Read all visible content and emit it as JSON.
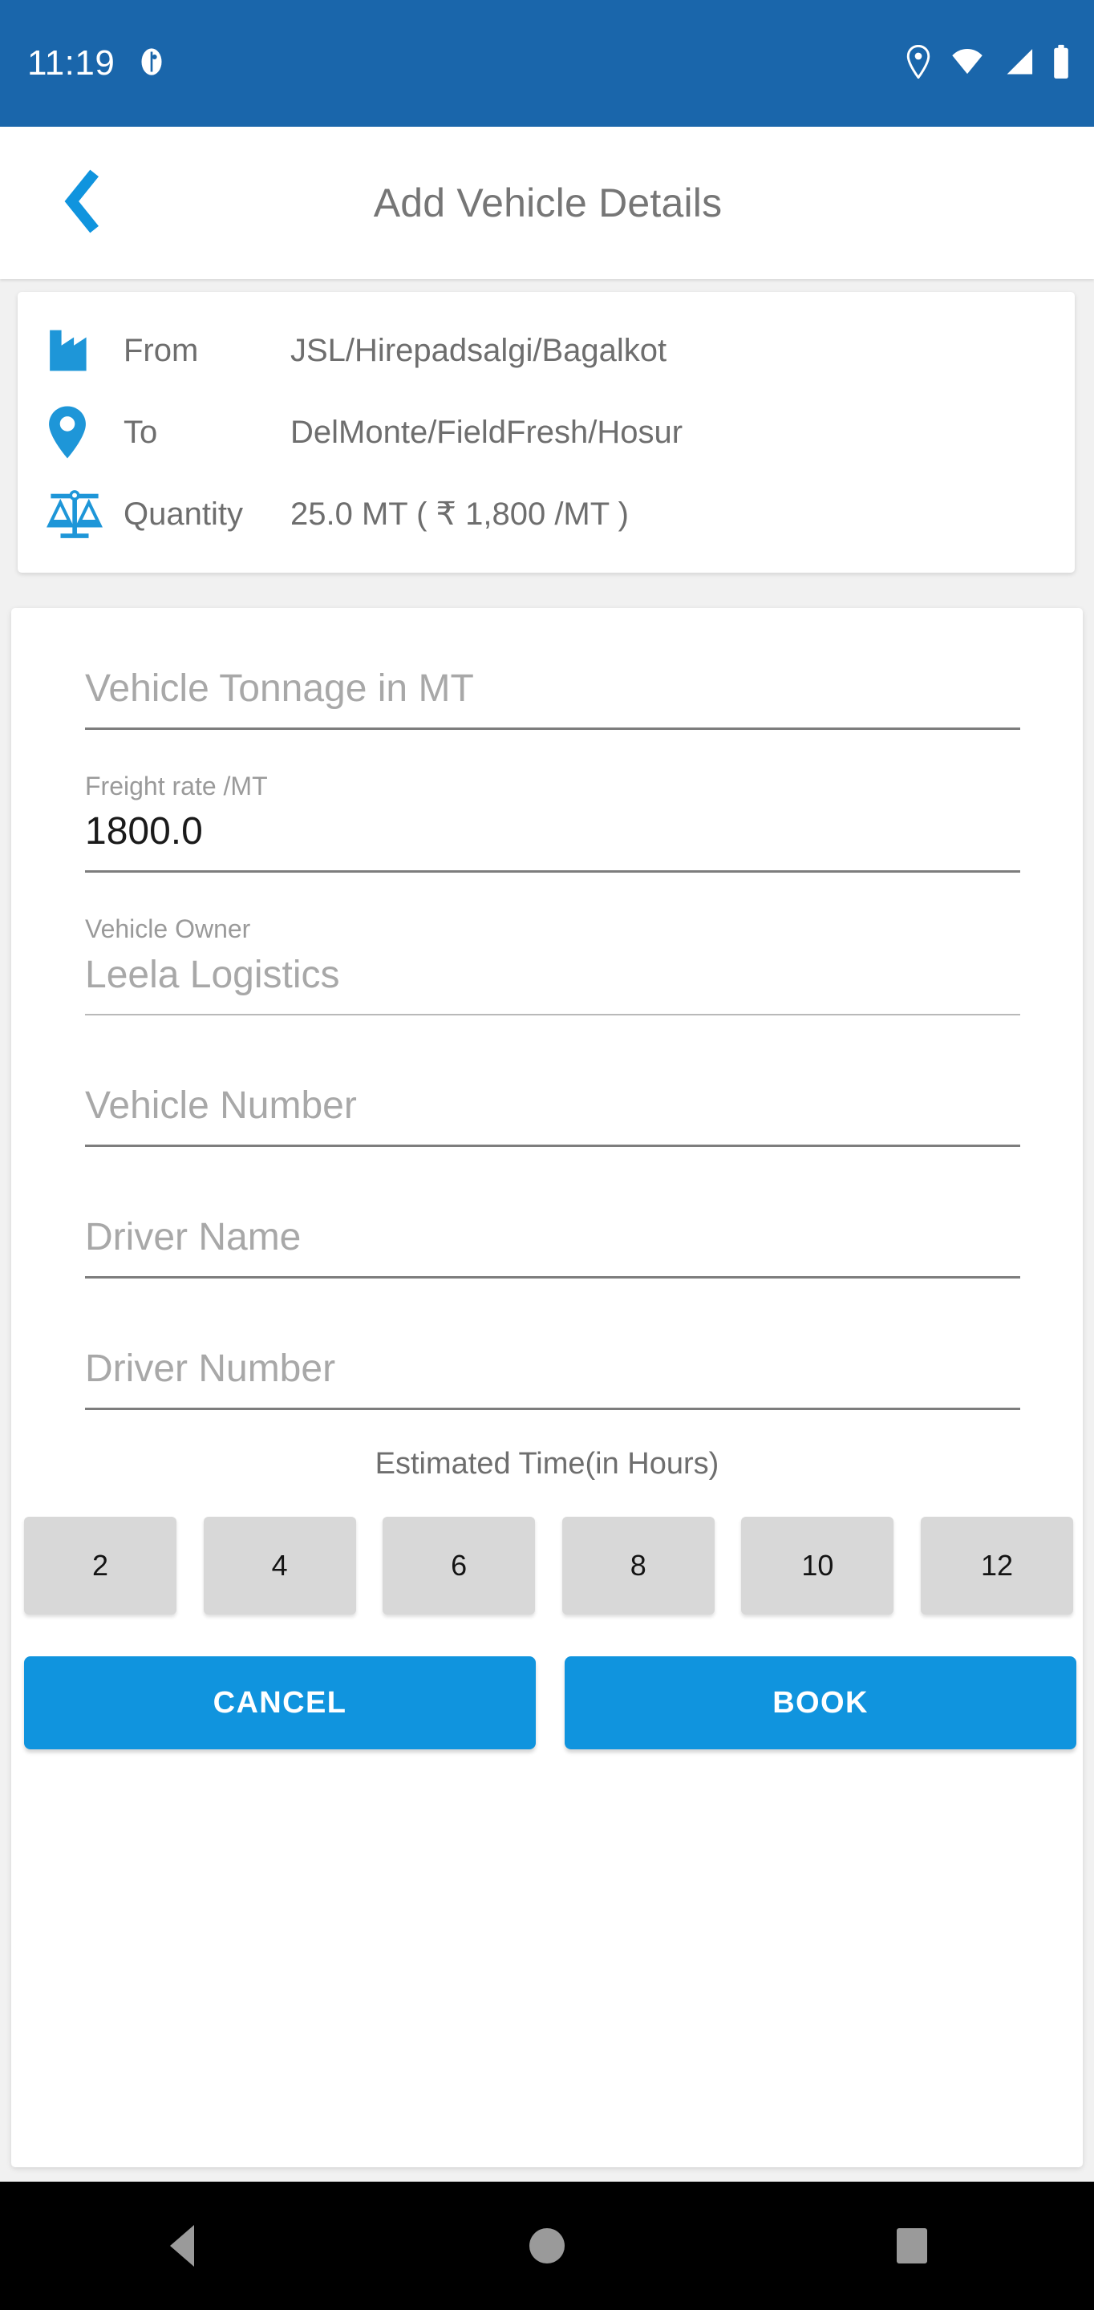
{
  "status_bar": {
    "time": "11:19",
    "notification_icon": "app-notification-icon",
    "icons": [
      "location-pin-icon",
      "wifi-icon",
      "cellular-signal-icon",
      "battery-icon"
    ],
    "background_color": "#1a66ab"
  },
  "app_bar": {
    "back_icon": "chevron-left-icon",
    "title": "Add Vehicle Details",
    "accent_color": "#1094de"
  },
  "info_card": {
    "rows": [
      {
        "icon": "factory-icon",
        "label": "From",
        "value": "JSL/Hirepadsalgi/Bagalkot"
      },
      {
        "icon": "map-pin-icon",
        "label": "To",
        "value": "DelMonte/FieldFresh/Hosur"
      },
      {
        "icon": "balance-scale-icon",
        "label": "Quantity",
        "value": "25.0 MT  ( ₹ 1,800 /MT )"
      }
    ]
  },
  "form": {
    "tonnage": {
      "label": "",
      "placeholder": "Vehicle Tonnage in MT",
      "value": ""
    },
    "freight_rate": {
      "label": "Freight rate /MT",
      "placeholder": "",
      "value": "1800.0"
    },
    "vehicle_owner": {
      "label": "Vehicle Owner",
      "placeholder": "Leela Logistics",
      "value": ""
    },
    "vehicle_number": {
      "label": "",
      "placeholder": "Vehicle Number",
      "value": ""
    },
    "driver_name": {
      "label": "",
      "placeholder": "Driver Name",
      "value": ""
    },
    "driver_number": {
      "label": "",
      "placeholder": "Driver Number",
      "value": ""
    },
    "estimated_time_label": "Estimated Time(in Hours)",
    "estimated_time_options": [
      "2",
      "4",
      "6",
      "8",
      "10",
      "12"
    ]
  },
  "actions": {
    "cancel_label": "CANCEL",
    "book_label": "BOOK",
    "button_color": "#1094de"
  },
  "nav_bar": {
    "back": "nav-back-icon",
    "home": "nav-home-icon",
    "recents": "nav-recents-icon"
  }
}
